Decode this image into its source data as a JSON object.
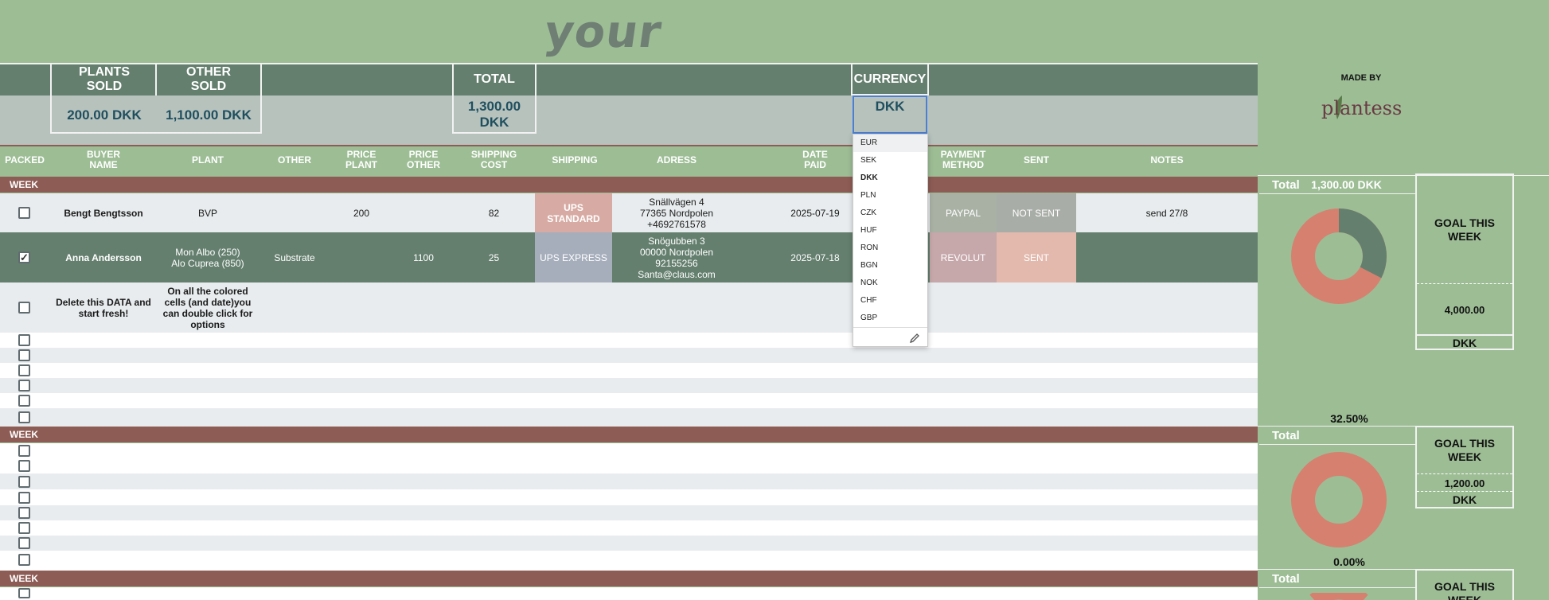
{
  "header": {
    "title": "your name",
    "made_by_label": "MADE BY",
    "brand_logo_text": "plantess"
  },
  "summary": {
    "plants_sold_label": "PLANTS SOLD",
    "other_sold_label": "OTHER SOLD",
    "total_label": "TOTAL",
    "currency_label": "CURRENCY",
    "plants_sold_value": "200.00 DKK",
    "other_sold_value": "1,100.00 DKK",
    "total_value": "1,300.00 DKK",
    "currency_value": "DKK"
  },
  "currency_dropdown": {
    "options": [
      "EUR",
      "SEK",
      "DKK",
      "PLN",
      "CZK",
      "HUF",
      "RON",
      "BGN",
      "NOK",
      "CHF",
      "GBP"
    ],
    "selected": "DKK",
    "edit_icon": "pencil-icon"
  },
  "columns": {
    "packed": "PACKED",
    "buyer_name": "BUYER NAME",
    "plant": "PLANT",
    "other": "OTHER",
    "price_plant": "PRICE PLANT",
    "price_other": "PRICE OTHER",
    "shipping_cost": "SHIPPING COST",
    "shipping": "SHIPPING",
    "adress": "ADRESS",
    "date_paid": "DATE PAID",
    "payment_method": "PAYMENT METHOD",
    "sent": "SENT",
    "notes": "NOTES"
  },
  "week_label": "WEEK",
  "rows": [
    {
      "packed": false,
      "buyer": "Bengt Bengtsson",
      "plant": "BVP",
      "other": "",
      "price_plant": "200",
      "price_other": "",
      "shipping_cost": "82",
      "shipping": "UPS STANDARD",
      "adress_1": "Snällvägen 4",
      "adress_2": "77365 Nordpolen",
      "adress_3": "+4692761578",
      "adress_4": "",
      "date_paid": "2025-07-19",
      "payment_method": "PAYPAL",
      "sent": "NOT SENT",
      "notes": "send 27/8"
    },
    {
      "packed": true,
      "buyer": "Anna Andersson",
      "plant_1": "Mon Albo (250)",
      "plant_2": "Alo Cuprea (850)",
      "other": "Substrate",
      "price_plant": "",
      "price_other": "1100",
      "shipping_cost": "25",
      "shipping": "UPS EXPRESS",
      "adress_1": "Snögubben 3",
      "adress_2": "00000 Nordpolen",
      "adress_3": "92155256",
      "adress_4": "Santa@claus.com",
      "date_paid": "2025-07-18",
      "payment_method": "REVOLUT",
      "sent": "SENT",
      "notes": ""
    },
    {
      "packed": false,
      "buyer": "Delete this DATA and start fresh!",
      "plant": "On all the colored cells (and date)you can double click for options"
    }
  ],
  "weekly_panels": [
    {
      "total_label": "Total",
      "total_value": "1,300.00 DKK",
      "goal_title": "GOAL THIS WEEK",
      "goal_value": "4,000.00",
      "goal_currency": "DKK",
      "percent": "32.50%",
      "progress": 0.325
    },
    {
      "total_label": "Total",
      "total_value": "",
      "goal_title": "GOAL THIS WEEK",
      "goal_value": "1,200.00",
      "goal_currency": "DKK",
      "percent": "0.00%",
      "progress": 0.0
    },
    {
      "total_label": "Total",
      "goal_title": "GOAL THIS WEEK"
    }
  ],
  "colors": {
    "background": "#9dbd95",
    "header_band": "#647f6e",
    "summary_band": "#b7c2bd",
    "week_band": "#8d5c55",
    "ups_standard": "#d7aba4",
    "ups_express": "#a6aebc",
    "paypal": "#a8b1a4",
    "revolut": "#c6a7aa",
    "not_sent": "#a9ada7",
    "sent": "#e3b9ad",
    "donut_fill": "#d6806f",
    "donut_progress": "#647f6e"
  }
}
